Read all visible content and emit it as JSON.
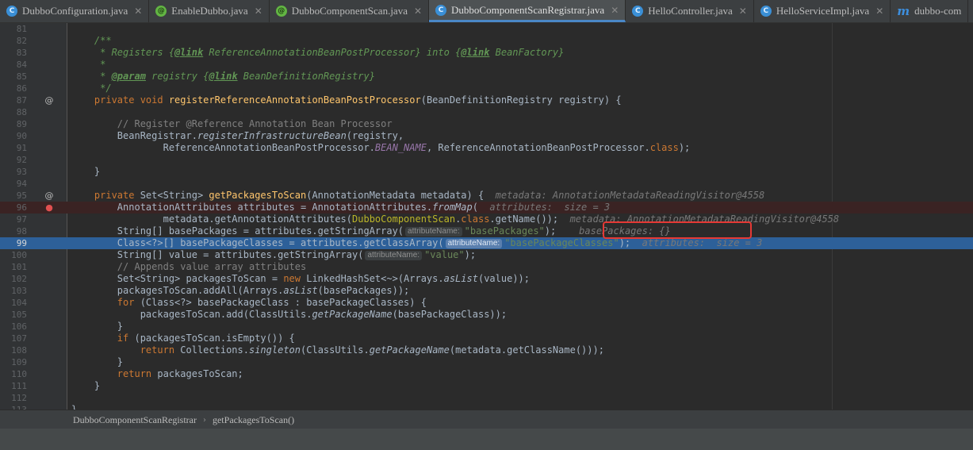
{
  "tabs": [
    {
      "label": "DubboConfiguration.java",
      "icon": "class-icon",
      "icon_glyph": "C",
      "active": false,
      "closable": true
    },
    {
      "label": "EnableDubbo.java",
      "icon": "annotation-icon",
      "icon_glyph": "@",
      "active": false,
      "closable": true
    },
    {
      "label": "DubboComponentScan.java",
      "icon": "annotation-icon",
      "icon_glyph": "@",
      "active": false,
      "closable": true
    },
    {
      "label": "DubboComponentScanRegistrar.java",
      "icon": "class-icon",
      "icon_glyph": "C",
      "active": true,
      "closable": true
    },
    {
      "label": "HelloController.java",
      "icon": "class-icon",
      "icon_glyph": "C",
      "active": false,
      "closable": true
    },
    {
      "label": "HelloServiceImpl.java",
      "icon": "class-icon",
      "icon_glyph": "C",
      "active": false,
      "closable": true
    },
    {
      "label": "dubbo-com",
      "icon": "maven-icon",
      "icon_glyph": "m",
      "active": false,
      "closable": false
    }
  ],
  "close_glyph": "✕",
  "editor": {
    "lines": [
      {
        "n": "81",
        "gutter": "",
        "state": "",
        "html": ""
      },
      {
        "n": "82",
        "gutter": "",
        "state": "",
        "html": "    <span class='doc'>/**</span>"
      },
      {
        "n": "83",
        "gutter": "",
        "state": "",
        "html": "     <span class='doc'>* Registers {</span><span class='doctag'>@link</span><span class='doc'> ReferenceAnnotationBeanPostProcessor} into {</span><span class='doctag'>@link</span><span class='doc'> BeanFactory}</span>"
      },
      {
        "n": "84",
        "gutter": "",
        "state": "",
        "html": "     <span class='doc'>*</span>"
      },
      {
        "n": "85",
        "gutter": "",
        "state": "",
        "html": "     <span class='doc'>* </span><span class='doctag'>@param</span><span class='doc'> registry {</span><span class='doctag'>@link</span><span class='doc'> BeanDefinitionRegistry}</span>"
      },
      {
        "n": "86",
        "gutter": "",
        "state": "",
        "html": "     <span class='doc'>*/</span>"
      },
      {
        "n": "87",
        "gutter": "@",
        "state": "",
        "html": "    <span class='kw'>private void </span><span class='fn'>registerReferenceAnnotationBeanPostProcessor</span>(BeanDefinitionRegistry registry) {"
      },
      {
        "n": "88",
        "gutter": "",
        "state": "",
        "html": ""
      },
      {
        "n": "89",
        "gutter": "",
        "state": "",
        "html": "        <span class='cm'>// Register @Reference Annotation Bean Processor</span>"
      },
      {
        "n": "90",
        "gutter": "",
        "state": "",
        "html": "        BeanRegistrar.<span class='it'>registerInfrastructureBean</span>(registry,"
      },
      {
        "n": "91",
        "gutter": "",
        "state": "",
        "html": "                ReferenceAnnotationBeanPostProcessor.<span class='cn'>BEAN_NAME</span>, ReferenceAnnotationBeanPostProcessor.<span class='kw'>class</span>);"
      },
      {
        "n": "92",
        "gutter": "",
        "state": "",
        "html": ""
      },
      {
        "n": "93",
        "gutter": "",
        "state": "",
        "html": "    }"
      },
      {
        "n": "94",
        "gutter": "",
        "state": "",
        "html": ""
      },
      {
        "n": "95",
        "gutter": "@",
        "state": "",
        "html": "    <span class='kw'>private </span>Set&lt;String&gt; <span class='fn'>getPackagesToScan</span>(AnnotationMetadata metadata) {  <span class='dbg'>metadata: AnnotationMetadataReadingVisitor@4558</span>"
      },
      {
        "n": "96",
        "gutter": "●",
        "state": "bp",
        "html": "        AnnotationAttributes attributes = AnnotationAttributes.<span class='it'>fromMap</span>(  <span class='dbg'>attributes:  size = 3</span>"
      },
      {
        "n": "97",
        "gutter": "",
        "state": "",
        "html": "                metadata.getAnnotationAttributes(<span class='an'>DubboComponentScan</span>.<span class='kw'>class</span>.getName());  <span class='dbg'>metadata: AnnotationMetadataReadingVisitor@4558</span>"
      },
      {
        "n": "98",
        "gutter": "",
        "state": "",
        "html": "        String[] basePackages = attributes.getStringArray(<span class='hint'>attributeName:</span><span class='st'>\"basePackages\"</span>);    <span class='dbg'>basePackages: {}</span>"
      },
      {
        "n": "99",
        "gutter": "",
        "state": "exec",
        "html": "        Class&lt;?&gt;[] basePackageClasses = attributes.getClassArray(<span class='hint'>attributeName:</span><span class='st'>\"basePackageClasses\"</span>);  <span class='dbg'>attributes:  size = 3</span>"
      },
      {
        "n": "100",
        "gutter": "",
        "state": "",
        "html": "        String[] value = attributes.getStringArray(<span class='hint'>attributeName:</span><span class='st'>\"value\"</span>);"
      },
      {
        "n": "101",
        "gutter": "",
        "state": "",
        "html": "        <span class='cm'>// Appends value array attributes</span>"
      },
      {
        "n": "102",
        "gutter": "",
        "state": "",
        "html": "        Set&lt;String&gt; packagesToScan = <span class='kw'>new </span>LinkedHashSet&lt;~&gt;(Arrays.<span class='it'>asList</span>(value));"
      },
      {
        "n": "103",
        "gutter": "",
        "state": "",
        "html": "        packagesToScan.addAll(Arrays.<span class='it'>asList</span>(basePackages));"
      },
      {
        "n": "104",
        "gutter": "",
        "state": "",
        "html": "        <span class='kw'>for </span>(Class&lt;?&gt; basePackageClass : basePackageClasses) {"
      },
      {
        "n": "105",
        "gutter": "",
        "state": "",
        "html": "            packagesToScan.add(ClassUtils.<span class='it'>getPackageName</span>(basePackageClass));"
      },
      {
        "n": "106",
        "gutter": "",
        "state": "",
        "html": "        }"
      },
      {
        "n": "107",
        "gutter": "",
        "state": "",
        "html": "        <span class='kw'>if </span>(packagesToScan.isEmpty()) {"
      },
      {
        "n": "108",
        "gutter": "",
        "state": "",
        "html": "            <span class='kw'>return </span>Collections.<span class='it'>singleton</span>(ClassUtils.<span class='it'>getPackageName</span>(metadata.getClassName()));"
      },
      {
        "n": "109",
        "gutter": "",
        "state": "",
        "html": "        }"
      },
      {
        "n": "110",
        "gutter": "",
        "state": "",
        "html": "        <span class='kw'>return </span>packagesToScan;"
      },
      {
        "n": "111",
        "gutter": "",
        "state": "",
        "html": "    }"
      },
      {
        "n": "112",
        "gutter": "",
        "state": "",
        "html": ""
      },
      {
        "n": "113",
        "gutter": "",
        "state": "",
        "html": "}"
      }
    ]
  },
  "breadcrumb": {
    "class_name": "DubboComponentScanRegistrar",
    "separator": "›",
    "method_name": "getPackagesToScan()"
  }
}
